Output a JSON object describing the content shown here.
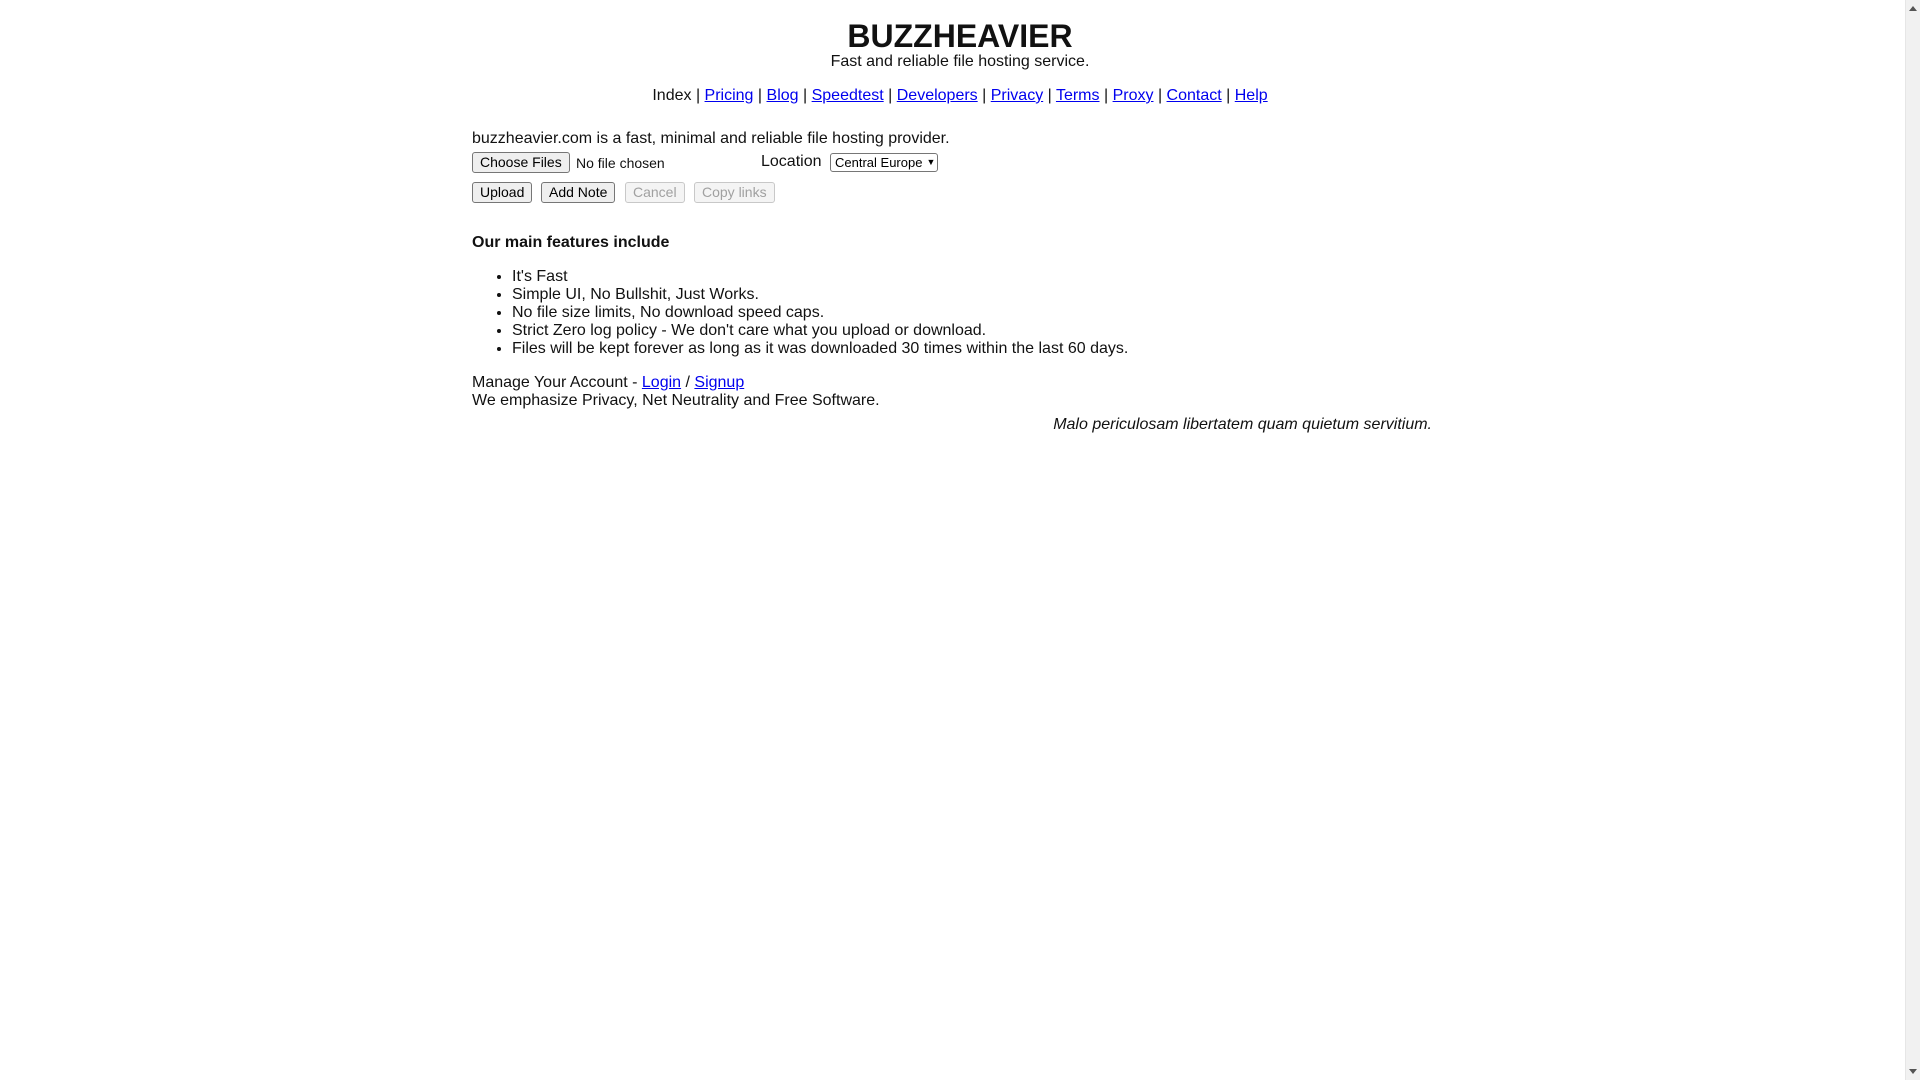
{
  "header": {
    "title": "BUZZHEAVIER",
    "tagline": "Fast and reliable file hosting service."
  },
  "nav": {
    "current": "Index",
    "separator": "|",
    "links": [
      "Pricing",
      "Blog",
      "Speedtest",
      "Developers",
      "Privacy",
      "Terms",
      "Proxy",
      "Contact",
      "Help"
    ]
  },
  "intro": "buzzheavier.com is a fast, minimal and reliable file hosting provider.",
  "upload": {
    "choose_label": "Choose Files",
    "file_status": "No file chosen",
    "location_label": "Location",
    "location_value": "Central Europe"
  },
  "actions": {
    "upload": "Upload",
    "add_note": "Add Note",
    "cancel": "Cancel",
    "copy_links": "Copy links"
  },
  "features": {
    "title": "Our main features include",
    "items": [
      "It's Fast",
      "Simple UI, No Bullshit, Just Works.",
      "No file size limits, No download speed caps.",
      "Strict Zero log policy - We don't care what you upload or download.",
      "Files will be kept forever as long as it was downloaded 30 times within the last 60 days."
    ]
  },
  "account": {
    "prefix": "Manage Your Account - ",
    "login": "Login",
    "slash": " / ",
    "signup": "Signup",
    "emphasis": "We emphasize Privacy, Net Neutrality and Free Software."
  },
  "quote": "Malo periculosam libertatem quam quietum servitium."
}
